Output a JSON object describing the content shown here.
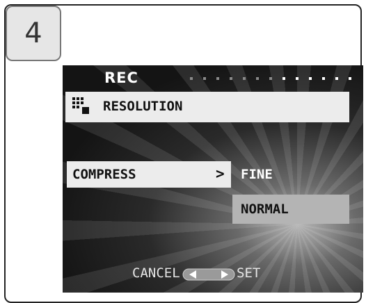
{
  "step": {
    "number": "4"
  },
  "screen": {
    "title": "REC",
    "menu_item": "RESOLUTION",
    "submenu": {
      "label": "COMPRESS",
      "arrow": ">",
      "options": [
        "FINE",
        "NORMAL"
      ],
      "selected": "NORMAL"
    },
    "footer": {
      "cancel_label": "CANCEL",
      "set_label": "SET"
    }
  },
  "icons": {
    "resolution": "resolution-grid-icon",
    "nav": "left-right-arrow-icon"
  },
  "colors": {
    "highlight_bar": "#ececec",
    "selected_option": "#b4b4b4",
    "lcd_background": "#141414"
  }
}
